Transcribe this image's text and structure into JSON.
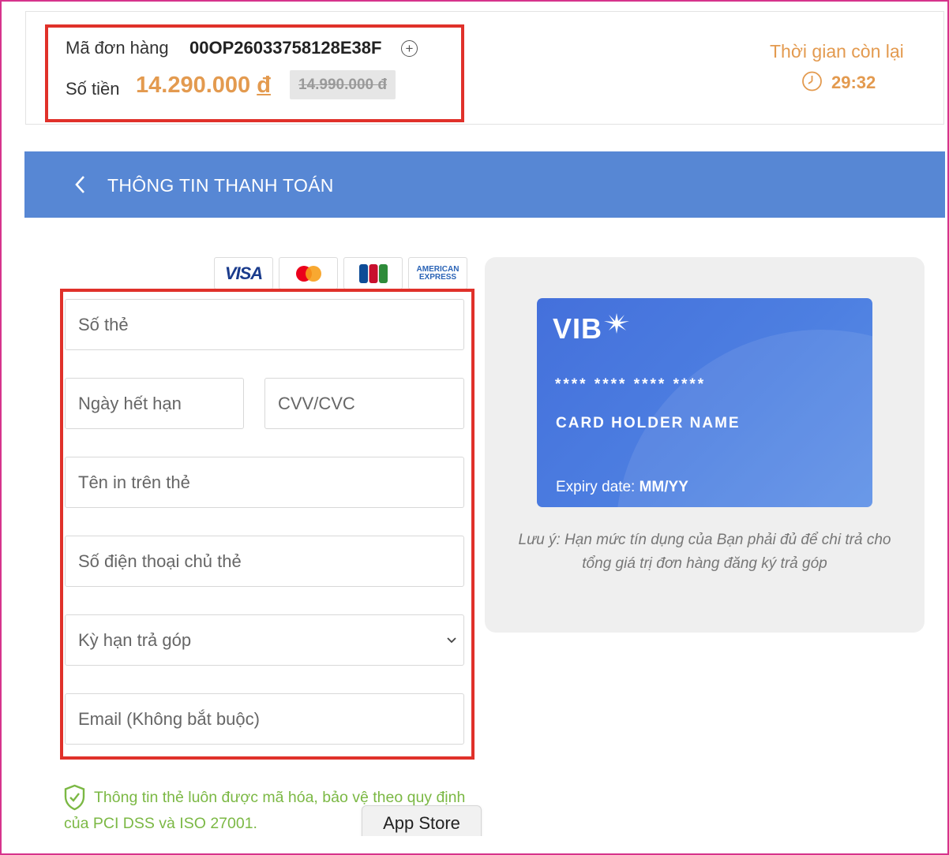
{
  "order": {
    "code_label": "Mã đơn hàng",
    "code": "00OP26033758128E38F",
    "amount_label": "Số tiền",
    "amount": "14.290.000",
    "currency": "đ",
    "old_amount": "14.990.000 đ",
    "timer_label": "Thời gian còn lại",
    "timer_value": "29:32"
  },
  "header": {
    "title": "THÔNG TIN THANH TOÁN"
  },
  "brands": {
    "visa": "VISA",
    "amex_line1": "AMERICAN",
    "amex_line2": "EXPRESS"
  },
  "form": {
    "card_number_placeholder": "Số thẻ",
    "expiry_placeholder": "Ngày hết hạn",
    "cvv_placeholder": "CVV/CVC",
    "name_placeholder": "Tên in trên thẻ",
    "phone_placeholder": "Số điện thoại chủ thẻ",
    "term_placeholder": "Kỳ hạn trả góp",
    "email_placeholder": "Email (Không bắt buộc)"
  },
  "card": {
    "bank": "VIB",
    "number": "**** **** **** ****",
    "holder": "CARD HOLDER NAME",
    "expiry_label": "Expiry date:",
    "expiry_value": "MM/YY"
  },
  "note": "Lưu ý: Hạn mức tín dụng của Bạn phải đủ để chi trả cho tổng giá trị đơn hàng đăng ký trả góp",
  "secure_text": "Thông tin thẻ luôn được mã hóa, bảo vệ theo quy định của PCI DSS và ISO 27001.",
  "app_store": "App Store",
  "colors": {
    "accent_orange": "#e39a4f",
    "header_blue": "#5787d4",
    "highlight_red": "#e0312a",
    "secure_green": "#7bb844"
  }
}
